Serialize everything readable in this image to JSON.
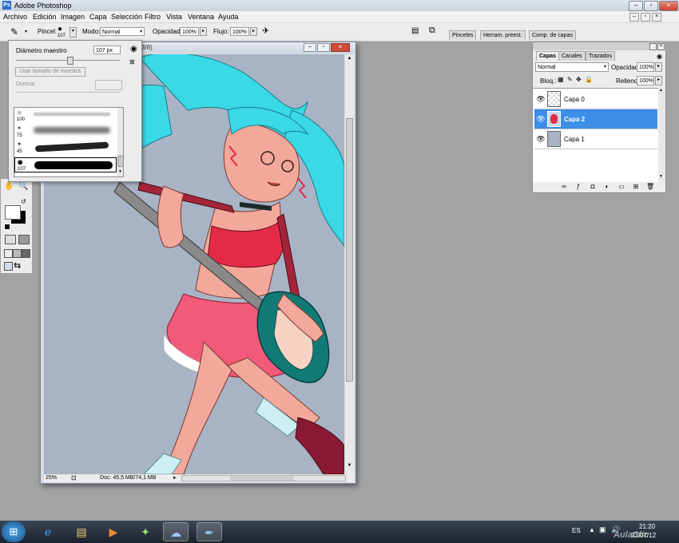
{
  "app": {
    "title": "Adobe Photoshop"
  },
  "menu": [
    "Archivo",
    "Edición",
    "Imagen",
    "Capa",
    "Selección",
    "Filtro",
    "Vista",
    "Ventana",
    "Ayuda"
  ],
  "options_bar": {
    "brush_label": "Pincel:",
    "brush_size": "107",
    "mode_label": "Modo:",
    "mode_value": "Normal",
    "opacity_label": "Opacidad:",
    "opacity_value": "100%",
    "flow_label": "Flujo:",
    "flow_value": "100%",
    "well_tabs": [
      "Pinceles",
      "Herram. preest.",
      "Comp. de capas"
    ]
  },
  "brush_popup": {
    "diameter_label": "Diámetro maestro",
    "diameter_value": "107 px",
    "sample_button": "Usar tamaño de muestra",
    "hardness_label": "Dureza:",
    "brushes": [
      {
        "size": "100"
      },
      {
        "size": "75"
      },
      {
        "size": "45"
      },
      {
        "size": "107"
      }
    ]
  },
  "document": {
    "title_fragment": "3/8)",
    "zoom": "25%",
    "doc_info": "Doc: 45,5 MB/74,1 MB"
  },
  "layers": {
    "tabs": [
      "Capas",
      "Canales",
      "Trazados"
    ],
    "blend_mode": "Normal",
    "opacity_label": "Opacidad:",
    "opacity_value": "100%",
    "lock_label": "Bloq.:",
    "fill_label": "Relleno:",
    "fill_value": "100%",
    "items": [
      {
        "name": "Capa 0",
        "selected": false
      },
      {
        "name": "Capa 2",
        "selected": true
      },
      {
        "name": "Capa 1",
        "selected": false
      }
    ]
  },
  "taskbar": {
    "language": "ES",
    "time": "21:20",
    "date_partial": "23/07/12"
  },
  "watermark": "AulaClic",
  "colors": {
    "canvas_bg": "#a8b4c5",
    "hair": "#39d9e6",
    "skin": "#f2a89a",
    "top": "#e32b48",
    "skirt": "#f25a7a",
    "guitar": "#127a76",
    "selection": "#3d8ee6"
  }
}
